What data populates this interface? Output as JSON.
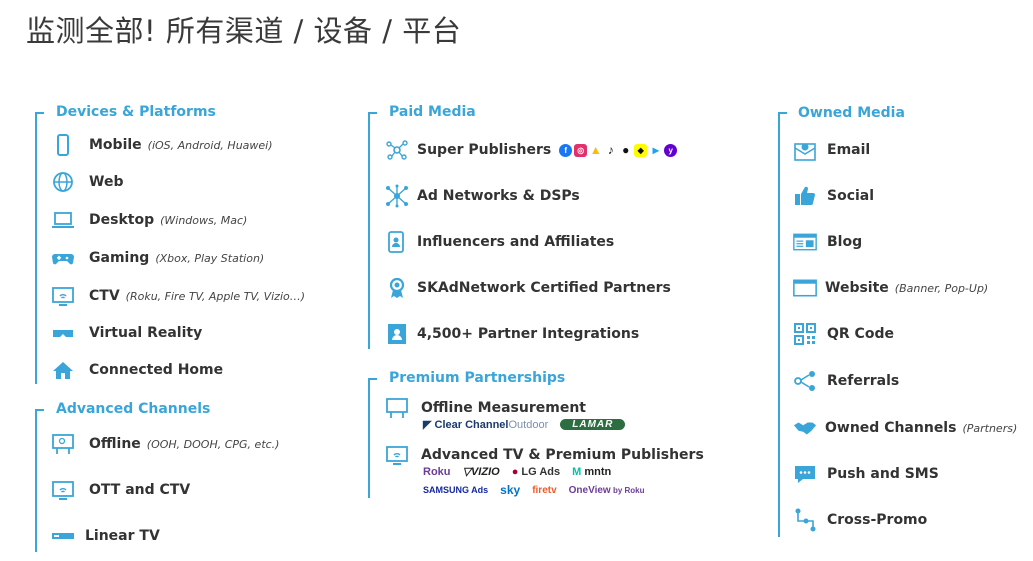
{
  "title": "监测全部! 所有渠道 / 设备 / 平台",
  "accent": "#3aa5d8",
  "left": {
    "sections": [
      {
        "title": "Devices & Platforms",
        "items": [
          {
            "label": "Mobile",
            "note": "(iOS, Android, Huawei)",
            "icon": "mobile-icon"
          },
          {
            "label": "Web",
            "note": "",
            "icon": "globe-icon"
          },
          {
            "label": "Desktop",
            "note": "(Windows, Mac)",
            "icon": "laptop-icon"
          },
          {
            "label": "Gaming",
            "note": "(Xbox, Play Station)",
            "icon": "gamepad-icon"
          },
          {
            "label": "CTV",
            "note": "(Roku, Fire TV, Apple TV, Vizio…)",
            "icon": "tv-icon"
          },
          {
            "label": "Virtual Reality",
            "note": "",
            "icon": "vr-headset-icon"
          },
          {
            "label": "Connected Home",
            "note": "",
            "icon": "smart-home-icon"
          }
        ]
      },
      {
        "title": "Advanced Channels",
        "items": [
          {
            "label": "Offline",
            "note": "(OOH, DOOH, CPG, etc.)",
            "icon": "billboard-icon"
          },
          {
            "label": "OTT and CTV",
            "note": "",
            "icon": "tv-icon"
          },
          {
            "label": "Linear TV",
            "note": "",
            "icon": "set-top-box-icon"
          }
        ]
      }
    ]
  },
  "middle": {
    "sections": [
      {
        "title": "Paid Media",
        "items": [
          {
            "label": "Super Publishers",
            "icon": "network-nodes-icon"
          },
          {
            "label": "Ad Networks & DSPs",
            "icon": "hub-icon"
          },
          {
            "label": "Influencers and Affiliates",
            "icon": "influencer-icon"
          },
          {
            "label": "SKAdNetwork Certified Partners",
            "icon": "award-ribbon-icon"
          },
          {
            "label": "4,500+ Partner Integrations",
            "icon": "contact-card-icon"
          }
        ]
      },
      {
        "title": "Premium Partnerships",
        "items": [
          {
            "label": "Offline Measurement",
            "icon": "billboard-icon"
          },
          {
            "label": "Advanced TV & Premium Publishers",
            "icon": "tv-icon"
          }
        ]
      }
    ],
    "super_publisher_logos": [
      "facebook-icon",
      "instagram-icon",
      "google-ads-icon",
      "tiktok-icon",
      "apple-icon",
      "snapchat-icon",
      "twitter-icon",
      "yahoo-icon"
    ],
    "offline_logos": {
      "clear_channel": "Clear Channel",
      "outdoor": " Outdoor",
      "lamar": "LAMAR"
    },
    "tv_logos_row1": {
      "roku": "Roku",
      "vizio": "VIZIO",
      "lg": "LG Ads",
      "mntn": "mntn"
    },
    "tv_logos_row2": {
      "samsung": "SAMSUNG Ads",
      "sky": "sky",
      "firetv": "firetv",
      "oneview": "OneView",
      "byroku": " by Roku"
    }
  },
  "right": {
    "sections": [
      {
        "title": "Owned Media",
        "items": [
          {
            "label": "Email",
            "note": "",
            "icon": "email-icon"
          },
          {
            "label": "Social",
            "note": "",
            "icon": "thumbs-up-icon"
          },
          {
            "label": "Blog",
            "note": "",
            "icon": "blog-icon"
          },
          {
            "label": "Website",
            "note": "(Banner, Pop-Up)",
            "icon": "browser-window-icon"
          },
          {
            "label": "QR Code",
            "note": "",
            "icon": "qr-code-icon"
          },
          {
            "label": "Referrals",
            "note": "",
            "icon": "share-icon"
          },
          {
            "label": "Owned Channels",
            "note": "(Partners)",
            "icon": "handshake-icon"
          },
          {
            "label": "Push and SMS",
            "note": "",
            "icon": "chat-bubble-icon"
          },
          {
            "label": "Cross-Promo",
            "note": "",
            "icon": "flow-icon"
          }
        ]
      }
    ]
  }
}
